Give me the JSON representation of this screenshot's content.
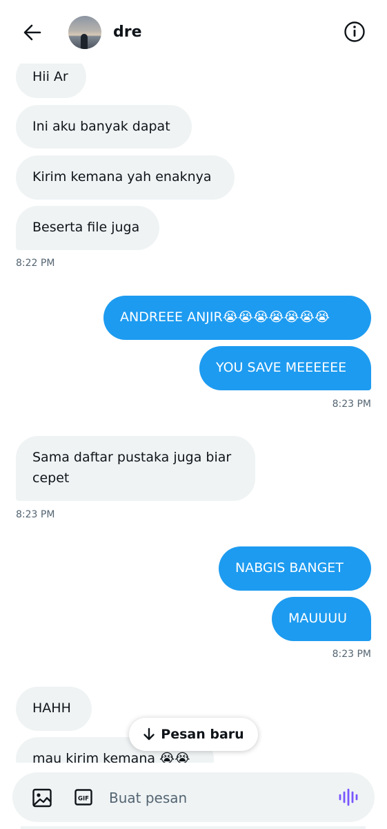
{
  "header": {
    "contact_name": "dre"
  },
  "messages": [
    {
      "side": "in",
      "text": "Hii Ar"
    },
    {
      "side": "in",
      "text": "Ini aku banyak dapat"
    },
    {
      "side": "in",
      "text": "Kirim kemana yah enaknya"
    },
    {
      "side": "in",
      "text": "Beserta file juga"
    },
    {
      "side": "in",
      "time": "8:22 PM"
    },
    {
      "side": "out",
      "text": "ANDREEE ANJIR😭😭😭😭😭😭😭"
    },
    {
      "side": "out",
      "text": "YOU SAVE MEEEEEE"
    },
    {
      "side": "out",
      "time": "8:23 PM"
    },
    {
      "side": "in",
      "text": "Sama daftar pustaka juga biar\ncepet"
    },
    {
      "side": "in",
      "time": "8:23 PM"
    },
    {
      "side": "out",
      "text": "NABGIS BANGET"
    },
    {
      "side": "out",
      "text": "MAUUUU"
    },
    {
      "side": "out",
      "time": "8:23 PM"
    },
    {
      "side": "in",
      "text": "HAHH"
    },
    {
      "side": "in",
      "text": "mau kirim kemana 😭😭"
    }
  ],
  "m": {
    "m1": "Hii Ar",
    "m2": "Ini aku banyak dapat",
    "m3": "Kirim kemana yah enaknya",
    "m4": "Beserta file juga",
    "t1": "8:22 PM",
    "m5": "ANDREEE ANJIR😭😭😭😭😭😭😭",
    "m6": "YOU SAVE MEEEEEE",
    "t2": "8:23 PM",
    "m7a": "Sama daftar pustaka juga biar",
    "m7b": "cepet",
    "t3": "8:23 PM",
    "m8": "NABGIS BANGET",
    "m9": "MAUUUU",
    "t4": "8:23 PM",
    "m10": "HAHH",
    "m11": "mau kirim kemana 😭😭"
  },
  "new_messages_pill": {
    "label": "Pesan baru",
    "icon": "arrow-down-icon"
  },
  "composer": {
    "placeholder": "Buat pesan",
    "icons": [
      "image-icon",
      "gif-icon",
      "voice-icon"
    ]
  },
  "colors": {
    "outgoing_bubble": "#1d9bf0",
    "incoming_bubble": "#eff3f4",
    "timestamp": "#536471",
    "voice_icon": "#7856ff"
  }
}
